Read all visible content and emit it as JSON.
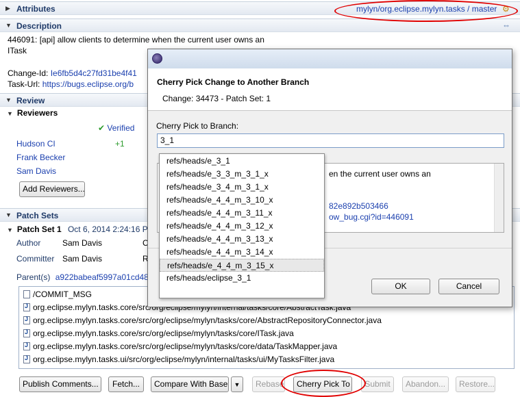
{
  "attributes": {
    "title": "Attributes",
    "branch": "mylyn/org.eclipse.mylyn.tasks / master"
  },
  "description": {
    "title": "Description",
    "line1": "446091: [api] allow clients to determine when the current user owns an",
    "line2": "ITask",
    "change_id_label": "Change-Id:",
    "change_id_value": "Ie6fb5d4c27fd31be4f41",
    "task_url_label": "Task-Url:",
    "task_url_value": "https://bugs.eclipse.org/b"
  },
  "review": {
    "title": "Review",
    "reviewers_title": "Reviewers",
    "verified_label": "Verified",
    "reviewers": [
      {
        "name": "Hudson CI",
        "score": "+1"
      },
      {
        "name": "Frank Becker",
        "score": ""
      },
      {
        "name": "Sam Davis",
        "score": ""
      }
    ],
    "add_reviewers_label": "Add Reviewers..."
  },
  "patch_sets": {
    "title": "Patch Sets",
    "patch_set_label": "Patch Set 1",
    "patch_set_date": "Oct 6, 2014 2:24:16 PM",
    "author_label": "Author",
    "author_value": "Sam Davis",
    "author_extra": "C",
    "committer_label": "Committer",
    "committer_value": "Sam Davis",
    "committer_extra": "R",
    "parents_label": "Parent(s)",
    "parents_value": "a922babeaf5997a01cd48d",
    "files": [
      {
        "icon": "commit-msg-icon",
        "path": "/COMMIT_MSG"
      },
      {
        "icon": "java-file-icon",
        "path": "org.eclipse.mylyn.tasks.core/src/org/eclipse/mylyn/internal/tasks/core/AbstractTask.java"
      },
      {
        "icon": "java-file-icon",
        "path": "org.eclipse.mylyn.tasks.core/src/org/eclipse/mylyn/tasks/core/AbstractRepositoryConnector.java"
      },
      {
        "icon": "java-file-icon",
        "path": "org.eclipse.mylyn.tasks.core/src/org/eclipse/mylyn/tasks/core/ITask.java"
      },
      {
        "icon": "java-file-icon",
        "path": "org.eclipse.mylyn.tasks.core/src/org/eclipse/mylyn/tasks/core/data/TaskMapper.java"
      },
      {
        "icon": "java-file-icon",
        "path": "org.eclipse.mylyn.tasks.ui/src/org/eclipse/mylyn/internal/tasks/ui/MyTasksFilter.java"
      }
    ]
  },
  "toolbar": {
    "publish": "Publish Comments...",
    "fetch": "Fetch...",
    "compare": "Compare With Base",
    "rebase": "Rebase",
    "cherry_pick": "Cherry Pick To",
    "submit": "Submit",
    "abandon": "Abandon...",
    "restore": "Restore..."
  },
  "dialog": {
    "title": "Cherry Pick Change to Another Branch",
    "subtitle": "Change: 34473 - Patch Set: 1",
    "branch_label": "Cherry Pick to Branch:",
    "branch_value": "3_1",
    "message_line1": "en the current user owns an",
    "message_link1": "82e892b503466",
    "message_link2": "ow_bug.cgi?id=446091",
    "ok_label": "OK",
    "cancel_label": "Cancel",
    "suggestions": [
      "refs/heads/e_3_1",
      "refs/heads/e_3_3_m_3_1_x",
      "refs/heads/e_3_4_m_3_1_x",
      "refs/heads/e_4_4_m_3_10_x",
      "refs/heads/e_4_4_m_3_11_x",
      "refs/heads/e_4_4_m_3_12_x",
      "refs/heads/e_4_4_m_3_13_x",
      "refs/heads/e_4_4_m_3_14_x",
      "refs/heads/e_4_4_m_3_15_x",
      "refs/heads/eclipse_3_1"
    ],
    "selected_suggestion": "refs/heads/e_4_4_m_3_15_x"
  },
  "colors": {
    "link": "#1a3fae",
    "header_text": "#1f3a68",
    "annotation_red": "#e00000",
    "verified_green": "#2c9b2c"
  }
}
